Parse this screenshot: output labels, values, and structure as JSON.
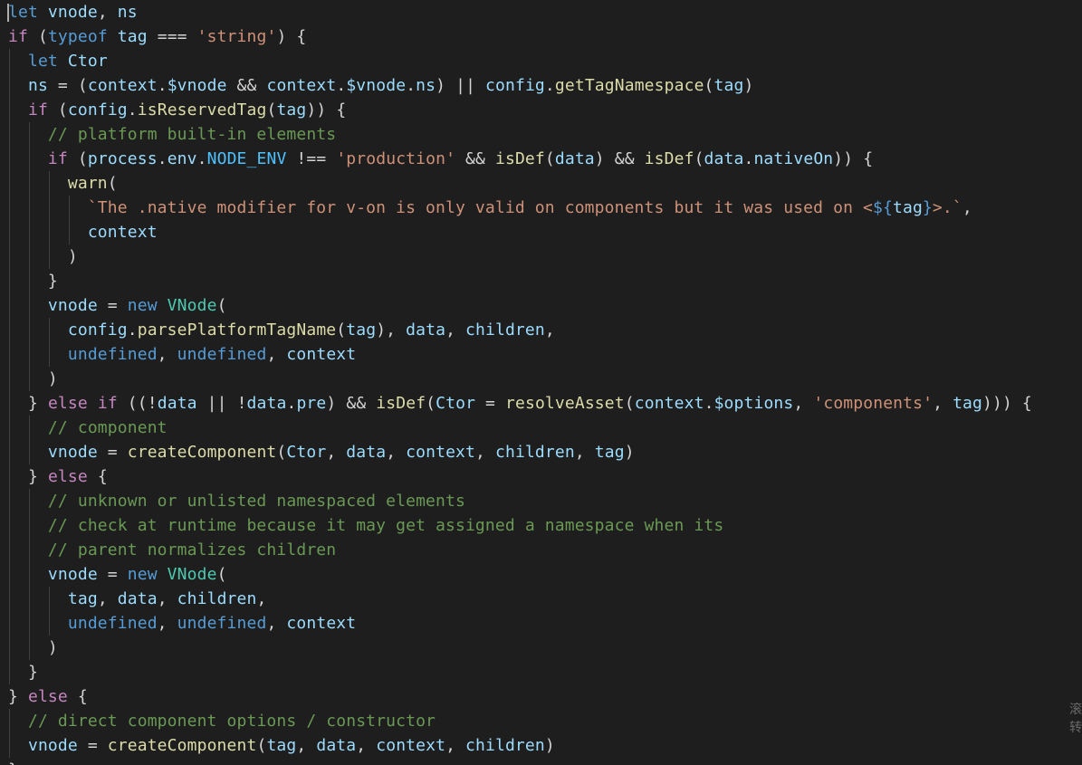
{
  "editor": {
    "language": "javascript",
    "theme": {
      "background": "#1e1e1e",
      "default_text": "#d4d4d4",
      "keyword": "#569cd6",
      "control_keyword": "#c586c0",
      "variable": "#9cdcfe",
      "function": "#dcdcaa",
      "class": "#4ec9b0",
      "string": "#ce9178",
      "comment": "#6a9955",
      "constant": "#4fc1ff",
      "indent_guide": "#404040"
    },
    "lines": [
      {
        "indent": 0,
        "tokens": [
          [
            "kw",
            "let"
          ],
          [
            "op",
            " "
          ],
          [
            "var",
            "vnode"
          ],
          [
            "op",
            ", "
          ],
          [
            "var",
            "ns"
          ]
        ]
      },
      {
        "indent": 0,
        "tokens": [
          [
            "ctl",
            "if"
          ],
          [
            "op",
            " ("
          ],
          [
            "kw",
            "typeof"
          ],
          [
            "op",
            " "
          ],
          [
            "var",
            "tag"
          ],
          [
            "op",
            " === "
          ],
          [
            "str",
            "'string'"
          ],
          [
            "op",
            ") {"
          ]
        ]
      },
      {
        "indent": 1,
        "tokens": [
          [
            "kw",
            "let"
          ],
          [
            "op",
            " "
          ],
          [
            "var",
            "Ctor"
          ]
        ]
      },
      {
        "indent": 1,
        "tokens": [
          [
            "var",
            "ns"
          ],
          [
            "op",
            " = ("
          ],
          [
            "var",
            "context"
          ],
          [
            "op",
            "."
          ],
          [
            "var",
            "$vnode"
          ],
          [
            "op",
            " && "
          ],
          [
            "var",
            "context"
          ],
          [
            "op",
            "."
          ],
          [
            "var",
            "$vnode"
          ],
          [
            "op",
            "."
          ],
          [
            "var",
            "ns"
          ],
          [
            "op",
            ") || "
          ],
          [
            "var",
            "config"
          ],
          [
            "op",
            "."
          ],
          [
            "fn",
            "getTagNamespace"
          ],
          [
            "op",
            "("
          ],
          [
            "var",
            "tag"
          ],
          [
            "op",
            ")"
          ]
        ]
      },
      {
        "indent": 1,
        "tokens": [
          [
            "ctl",
            "if"
          ],
          [
            "op",
            " ("
          ],
          [
            "var",
            "config"
          ],
          [
            "op",
            "."
          ],
          [
            "fn",
            "isReservedTag"
          ],
          [
            "op",
            "("
          ],
          [
            "var",
            "tag"
          ],
          [
            "op",
            ")) {"
          ]
        ]
      },
      {
        "indent": 2,
        "tokens": [
          [
            "com",
            "// platform built-in elements"
          ]
        ]
      },
      {
        "indent": 2,
        "tokens": [
          [
            "ctl",
            "if"
          ],
          [
            "op",
            " ("
          ],
          [
            "var",
            "process"
          ],
          [
            "op",
            "."
          ],
          [
            "var",
            "env"
          ],
          [
            "op",
            "."
          ],
          [
            "con",
            "NODE_ENV"
          ],
          [
            "op",
            " !== "
          ],
          [
            "str",
            "'production'"
          ],
          [
            "op",
            " && "
          ],
          [
            "fn",
            "isDef"
          ],
          [
            "op",
            "("
          ],
          [
            "var",
            "data"
          ],
          [
            "op",
            ") && "
          ],
          [
            "fn",
            "isDef"
          ],
          [
            "op",
            "("
          ],
          [
            "var",
            "data"
          ],
          [
            "op",
            "."
          ],
          [
            "var",
            "nativeOn"
          ],
          [
            "op",
            ")) {"
          ]
        ]
      },
      {
        "indent": 3,
        "tokens": [
          [
            "fn",
            "warn"
          ],
          [
            "op",
            "("
          ]
        ]
      },
      {
        "indent": 4,
        "tokens": [
          [
            "str",
            "`The .native modifier for v-on is only valid on components but it was used on <"
          ],
          [
            "kw",
            "${"
          ],
          [
            "var",
            "tag"
          ],
          [
            "kw",
            "}"
          ],
          [
            "str",
            ">.`"
          ],
          [
            "op",
            ","
          ]
        ]
      },
      {
        "indent": 4,
        "tokens": [
          [
            "var",
            "context"
          ]
        ]
      },
      {
        "indent": 3,
        "tokens": [
          [
            "op",
            ")"
          ]
        ]
      },
      {
        "indent": 2,
        "tokens": [
          [
            "op",
            "}"
          ]
        ]
      },
      {
        "indent": 2,
        "tokens": [
          [
            "var",
            "vnode"
          ],
          [
            "op",
            " = "
          ],
          [
            "kw",
            "new"
          ],
          [
            "op",
            " "
          ],
          [
            "cls",
            "VNode"
          ],
          [
            "op",
            "("
          ]
        ]
      },
      {
        "indent": 3,
        "tokens": [
          [
            "var",
            "config"
          ],
          [
            "op",
            "."
          ],
          [
            "fn",
            "parsePlatformTagName"
          ],
          [
            "op",
            "("
          ],
          [
            "var",
            "tag"
          ],
          [
            "op",
            "), "
          ],
          [
            "var",
            "data"
          ],
          [
            "op",
            ", "
          ],
          [
            "var",
            "children"
          ],
          [
            "op",
            ","
          ]
        ]
      },
      {
        "indent": 3,
        "tokens": [
          [
            "kw",
            "undefined"
          ],
          [
            "op",
            ", "
          ],
          [
            "kw",
            "undefined"
          ],
          [
            "op",
            ", "
          ],
          [
            "var",
            "context"
          ]
        ]
      },
      {
        "indent": 2,
        "tokens": [
          [
            "op",
            ")"
          ]
        ]
      },
      {
        "indent": 1,
        "tokens": [
          [
            "op",
            "} "
          ],
          [
            "ctl",
            "else"
          ],
          [
            "op",
            " "
          ],
          [
            "ctl",
            "if"
          ],
          [
            "op",
            " ((!"
          ],
          [
            "var",
            "data"
          ],
          [
            "op",
            " || !"
          ],
          [
            "var",
            "data"
          ],
          [
            "op",
            "."
          ],
          [
            "var",
            "pre"
          ],
          [
            "op",
            ") && "
          ],
          [
            "fn",
            "isDef"
          ],
          [
            "op",
            "("
          ],
          [
            "var",
            "Ctor"
          ],
          [
            "op",
            " = "
          ],
          [
            "fn",
            "resolveAsset"
          ],
          [
            "op",
            "("
          ],
          [
            "var",
            "context"
          ],
          [
            "op",
            "."
          ],
          [
            "var",
            "$options"
          ],
          [
            "op",
            ", "
          ],
          [
            "str",
            "'components'"
          ],
          [
            "op",
            ", "
          ],
          [
            "var",
            "tag"
          ],
          [
            "op",
            "))) {"
          ]
        ]
      },
      {
        "indent": 2,
        "tokens": [
          [
            "com",
            "// component"
          ]
        ]
      },
      {
        "indent": 2,
        "tokens": [
          [
            "var",
            "vnode"
          ],
          [
            "op",
            " = "
          ],
          [
            "fn",
            "createComponent"
          ],
          [
            "op",
            "("
          ],
          [
            "var",
            "Ctor"
          ],
          [
            "op",
            ", "
          ],
          [
            "var",
            "data"
          ],
          [
            "op",
            ", "
          ],
          [
            "var",
            "context"
          ],
          [
            "op",
            ", "
          ],
          [
            "var",
            "children"
          ],
          [
            "op",
            ", "
          ],
          [
            "var",
            "tag"
          ],
          [
            "op",
            ")"
          ]
        ]
      },
      {
        "indent": 1,
        "tokens": [
          [
            "op",
            "} "
          ],
          [
            "ctl",
            "else"
          ],
          [
            "op",
            " {"
          ]
        ]
      },
      {
        "indent": 2,
        "tokens": [
          [
            "com",
            "// unknown or unlisted namespaced elements"
          ]
        ]
      },
      {
        "indent": 2,
        "tokens": [
          [
            "com",
            "// check at runtime because it may get assigned a namespace when its"
          ]
        ]
      },
      {
        "indent": 2,
        "tokens": [
          [
            "com",
            "// parent normalizes children"
          ]
        ]
      },
      {
        "indent": 2,
        "tokens": [
          [
            "var",
            "vnode"
          ],
          [
            "op",
            " = "
          ],
          [
            "kw",
            "new"
          ],
          [
            "op",
            " "
          ],
          [
            "cls",
            "VNode"
          ],
          [
            "op",
            "("
          ]
        ]
      },
      {
        "indent": 3,
        "tokens": [
          [
            "var",
            "tag"
          ],
          [
            "op",
            ", "
          ],
          [
            "var",
            "data"
          ],
          [
            "op",
            ", "
          ],
          [
            "var",
            "children"
          ],
          [
            "op",
            ","
          ]
        ]
      },
      {
        "indent": 3,
        "tokens": [
          [
            "kw",
            "undefined"
          ],
          [
            "op",
            ", "
          ],
          [
            "kw",
            "undefined"
          ],
          [
            "op",
            ", "
          ],
          [
            "var",
            "context"
          ]
        ]
      },
      {
        "indent": 2,
        "tokens": [
          [
            "op",
            ")"
          ]
        ]
      },
      {
        "indent": 1,
        "tokens": [
          [
            "op",
            "}"
          ]
        ]
      },
      {
        "indent": 0,
        "tokens": [
          [
            "op",
            "} "
          ],
          [
            "ctl",
            "else"
          ],
          [
            "op",
            " {"
          ]
        ]
      },
      {
        "indent": 1,
        "tokens": [
          [
            "com",
            "// direct component options / constructor"
          ]
        ]
      },
      {
        "indent": 1,
        "tokens": [
          [
            "var",
            "vnode"
          ],
          [
            "op",
            " = "
          ],
          [
            "fn",
            "createComponent"
          ],
          [
            "op",
            "("
          ],
          [
            "var",
            "tag"
          ],
          [
            "op",
            ", "
          ],
          [
            "var",
            "data"
          ],
          [
            "op",
            ", "
          ],
          [
            "var",
            "context"
          ],
          [
            "op",
            ", "
          ],
          [
            "var",
            "children"
          ],
          [
            "op",
            ")"
          ]
        ]
      },
      {
        "indent": 0,
        "tokens": [
          [
            "op",
            "}"
          ]
        ]
      }
    ]
  },
  "watermark": {
    "text": "滚 转"
  }
}
